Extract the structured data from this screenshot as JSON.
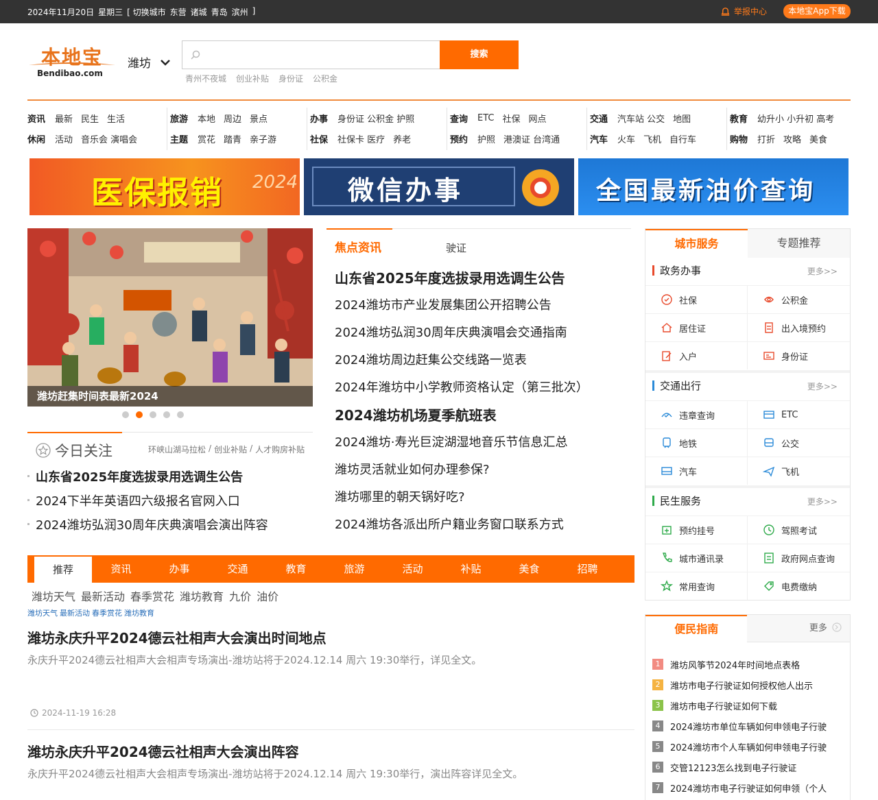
{
  "topbar": {
    "date_parts": [
      "2024年11月20日",
      "星期三",
      "[ 切换城市",
      "东营",
      "诸城",
      "青岛",
      "滨州",
      "]"
    ],
    "report": "举报中心",
    "app_download": "本地宝App下载"
  },
  "header": {
    "logo_cn": "本地宝",
    "logo_en": "Bendibao.com",
    "city": "潍坊",
    "search_placeholder": "",
    "search_button": "搜索",
    "hot_words": [
      "青州不夜城",
      "创业补贴",
      "身份证",
      "公积金"
    ]
  },
  "nav": [
    {
      "rows": [
        [
          "资讯",
          "最新",
          "民生",
          "生活"
        ],
        [
          "休闲",
          "活动",
          "音乐会 演唱会"
        ]
      ]
    },
    {
      "rows": [
        [
          "旅游",
          "本地",
          "周边",
          "景点"
        ],
        [
          "主题",
          "赏花",
          "踏青",
          "亲子游"
        ]
      ]
    },
    {
      "rows": [
        [
          "办事",
          "身份证 公积金 护照"
        ],
        [
          "社保",
          "社保卡 医疗",
          "养老"
        ]
      ]
    },
    {
      "rows": [
        [
          "查询",
          "ETC",
          "社保",
          "网点"
        ],
        [
          "预约",
          "护照",
          "港澳证 台湾通"
        ]
      ]
    },
    {
      "rows": [
        [
          "交通",
          "汽车站 公交",
          "地图"
        ],
        [
          "汽车",
          "火车",
          "飞机",
          "自行车"
        ]
      ]
    },
    {
      "rows": [
        [
          "教育",
          "幼升小 小升初 高考"
        ],
        [
          "购物",
          "打折",
          "攻略",
          "美食"
        ]
      ]
    }
  ],
  "banners": {
    "b1": "医保报销",
    "b1_year": "2024",
    "b2": "微信办事",
    "b3": "全国最新油价查询"
  },
  "slider": {
    "caption": "潍坊赶集时间表最新2024",
    "slide_count": 5,
    "active_index": 1
  },
  "today": {
    "title": "今日关注",
    "tags": [
      "环峡山湖马拉松",
      "/",
      "创业补贴",
      "/",
      "人才购房补贴"
    ],
    "items": [
      {
        "text": "山东省2025年度选拔录用选调生公告",
        "bold": true
      },
      {
        "text": "2024下半年英语四六级报名官网入口",
        "bold": false
      },
      {
        "text": "2024潍坊弘润30周年庆典演唱会演出阵容",
        "bold": false
      }
    ]
  },
  "focus": {
    "tab_active": "焦点资讯",
    "tab2": "驶证",
    "news": [
      {
        "text": "山东省2025年度选拔录用选调生公告",
        "big": true
      },
      {
        "text": "2024潍坊市产业发展集团公开招聘公告",
        "big": false
      },
      {
        "text": "2024潍坊弘润30周年庆典演唱会交通指南",
        "big": false
      },
      {
        "text": "2024潍坊周边赶集公交线路一览表",
        "big": false
      },
      {
        "text": "2024年潍坊中小学教师资格认定（第三批次）",
        "big": false
      },
      {
        "text": "2024潍坊机场夏季航班表",
        "big": true
      },
      {
        "text": "2024潍坊·寿光巨淀湖湿地音乐节信息汇总",
        "big": false
      },
      {
        "text": "潍坊灵活就业如何办理参保?",
        "big": false
      },
      {
        "text": "潍坊哪里的朝天锅好吃?",
        "big": false
      },
      {
        "text": "2024潍坊各派出所户籍业务窗口联系方式",
        "big": false
      }
    ]
  },
  "channels": {
    "tabs": [
      "推荐",
      "资讯",
      "办事",
      "交通",
      "教育",
      "旅游",
      "活动",
      "补贴",
      "美食",
      "招聘"
    ],
    "active": 0,
    "subtags": [
      "潍坊天气",
      "最新活动",
      "春季赏花",
      "潍坊教育",
      "九价",
      "油价"
    ],
    "microtags": [
      "潍坊天气",
      "最新活动",
      "春季赏花",
      "潍坊教育"
    ]
  },
  "articles": [
    {
      "title": "潍坊永庆升平2024德云社相声大会演出时间地点",
      "summary": "永庆升平2024德云社相声大会相声专场演出-潍坊站将于2024.12.14 周六 19:30举行，详见全文。",
      "time": "2024-11-19 16:28"
    },
    {
      "title": "潍坊永庆升平2024德云社相声大会演出阵容",
      "summary": "永庆升平2024德云社相声大会相声专场演出-潍坊站将于2024.12.14 周六 19:30举行，演出阵容详见全文。",
      "time": ""
    }
  ],
  "services": {
    "tab_active": "城市服务",
    "tab2": "专题推荐",
    "more": "更多>>",
    "sections": [
      {
        "title": "政务办事",
        "bar_color": "#e8492b",
        "items": [
          {
            "label": "社保",
            "icon": "shield-icon",
            "color": "#e8492b"
          },
          {
            "label": "公积金",
            "icon": "coin-icon",
            "color": "#e8492b"
          },
          {
            "label": "居住证",
            "icon": "home-icon",
            "color": "#e8492b"
          },
          {
            "label": "出入境预约",
            "icon": "document-icon",
            "color": "#e8492b"
          },
          {
            "label": "入户",
            "icon": "edit-icon",
            "color": "#e8492b"
          },
          {
            "label": "身份证",
            "icon": "id-card-icon",
            "color": "#e8492b"
          }
        ]
      },
      {
        "title": "交通出行",
        "bar_color": "#2a8ad8",
        "items": [
          {
            "label": "违章查询",
            "icon": "car-check-icon",
            "color": "#2a8ad8"
          },
          {
            "label": "ETC",
            "icon": "card-icon",
            "color": "#2a8ad8"
          },
          {
            "label": "地铁",
            "icon": "subway-icon",
            "color": "#2a8ad8"
          },
          {
            "label": "公交",
            "icon": "bus-icon",
            "color": "#2a8ad8"
          },
          {
            "label": "汽车",
            "icon": "coach-icon",
            "color": "#2a8ad8"
          },
          {
            "label": "飞机",
            "icon": "plane-icon",
            "color": "#2a8ad8"
          }
        ]
      },
      {
        "title": "民生服务",
        "bar_color": "#2eaa4a",
        "items": [
          {
            "label": "预约挂号",
            "icon": "medical-icon",
            "color": "#2eaa4a"
          },
          {
            "label": "驾照考试",
            "icon": "clock-icon",
            "color": "#2eaa4a"
          },
          {
            "label": "城市通讯录",
            "icon": "phone-icon",
            "color": "#2eaa4a"
          },
          {
            "label": "政府网点查询",
            "icon": "list-icon",
            "color": "#2eaa4a"
          },
          {
            "label": "常用查询",
            "icon": "star-icon",
            "color": "#2eaa4a"
          },
          {
            "label": "电费缴纳",
            "icon": "tag-icon",
            "color": "#2eaa4a"
          }
        ]
      }
    ]
  },
  "guide": {
    "title": "便民指南",
    "more": "更多",
    "items": [
      {
        "num": "1",
        "text": "潍坊风筝节2024年时间地点表格",
        "color": "#f28b82"
      },
      {
        "num": "2",
        "text": "潍坊市电子行驶证如何授权他人出示",
        "color": "#f5b342"
      },
      {
        "num": "3",
        "text": "潍坊市电子行驶证如何下载",
        "color": "#8bc34a"
      },
      {
        "num": "4",
        "text": "2024潍坊市单位车辆如何申领电子行驶",
        "color": "#888888"
      },
      {
        "num": "5",
        "text": "2024潍坊市个人车辆如何申领电子行驶",
        "color": "#888888"
      },
      {
        "num": "6",
        "text": "交管12123怎么找到电子行驶证",
        "color": "#888888"
      },
      {
        "num": "7",
        "text": "2024潍坊市电子行驶证如何申领（个人",
        "color": "#888888"
      }
    ]
  }
}
